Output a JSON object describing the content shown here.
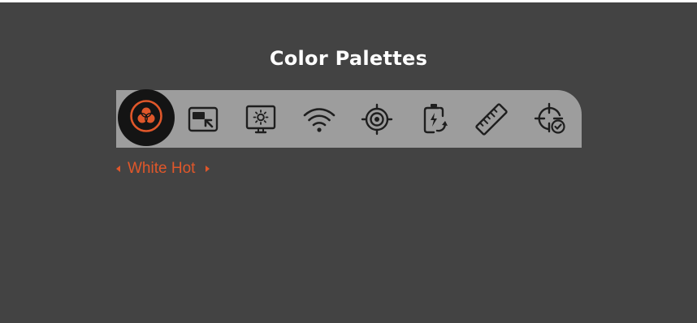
{
  "menu": {
    "title": "Color Palettes"
  },
  "toolbar": {
    "items": [
      {
        "icon": "color-palettes-icon",
        "active": true
      },
      {
        "icon": "picture-in-picture-icon",
        "active": false
      },
      {
        "icon": "display-brightness-icon",
        "active": false
      },
      {
        "icon": "wifi-icon",
        "active": false
      },
      {
        "icon": "target-tracking-icon",
        "active": false
      },
      {
        "icon": "battery-charging-icon",
        "active": false
      },
      {
        "icon": "ruler-icon",
        "active": false
      },
      {
        "icon": "crosshair-confirm-icon",
        "active": false
      }
    ]
  },
  "palette_selector": {
    "value": "White Hot"
  },
  "colors": {
    "background": "#434343",
    "toolbar": "#9d9d9d",
    "active_bg": "#141414",
    "accent": "#e0572a",
    "icon": "#1e1e1e"
  }
}
